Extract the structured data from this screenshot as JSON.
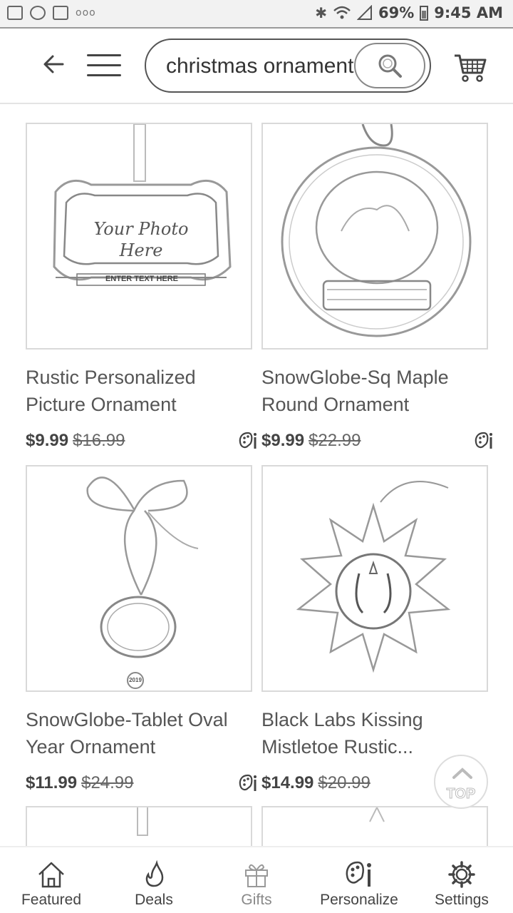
{
  "status_bar": {
    "battery": "69%",
    "time": "9:45 AM",
    "notification_icons": [
      "image-icon",
      "pinwheel-icon",
      "t-mobile-icon"
    ],
    "overflow": "ooo"
  },
  "header": {
    "search_value": "christmas ornament",
    "icons": [
      "back-arrow-icon",
      "hamburger-menu-icon",
      "search-icon",
      "cart-icon"
    ]
  },
  "products": [
    {
      "title": "Rustic Personalized Picture Ornament",
      "price": "$9.99",
      "old_price": "$16.99",
      "image_text": "Your Photo Here",
      "image_banner": "ENTER TEXT HERE"
    },
    {
      "title": "SnowGlobe-Sq Maple Round Ornament",
      "price": "$9.99",
      "old_price": "$22.99"
    },
    {
      "title": "SnowGlobe-Tablet Oval Year Ornament",
      "price": "$11.99",
      "old_price": "$24.99",
      "image_text": "2019"
    },
    {
      "title": "Black Labs Kissing Mistletoe Rustic...",
      "price": "$14.99",
      "old_price": "$20.99"
    }
  ],
  "top_button": {
    "label": "TOP"
  },
  "bottom_nav": [
    {
      "label": "Featured",
      "icon": "home-icon"
    },
    {
      "label": "Deals",
      "icon": "flame-icon"
    },
    {
      "label": "Gifts",
      "icon": "gift-icon"
    },
    {
      "label": "Personalize",
      "icon": "palette-icon"
    },
    {
      "label": "Settings",
      "icon": "gear-icon"
    }
  ]
}
